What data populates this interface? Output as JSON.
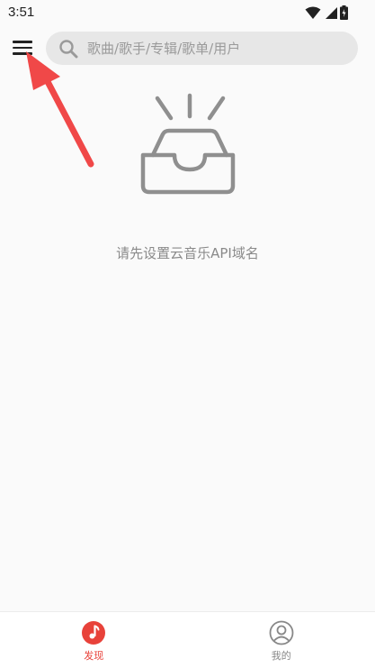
{
  "status_bar": {
    "time": "3:51",
    "icons": [
      "wifi-icon",
      "signal-icon",
      "battery-icon"
    ]
  },
  "top_bar": {
    "menu_icon": "hamburger-menu-icon",
    "search": {
      "placeholder": "歌曲/歌手/专辑/歌单/用户",
      "value": "",
      "icon": "search-icon"
    }
  },
  "empty_state": {
    "icon": "empty-inbox-icon",
    "message": "请先设置云音乐API域名"
  },
  "bottom_nav": {
    "tabs": [
      {
        "label": "发现",
        "icon": "music-note-icon",
        "active": true
      },
      {
        "label": "我的",
        "icon": "user-profile-icon",
        "active": false
      }
    ]
  },
  "colors": {
    "accent": "#e8423a",
    "inactive": "#888888",
    "annotation_arrow": "#f04848"
  }
}
